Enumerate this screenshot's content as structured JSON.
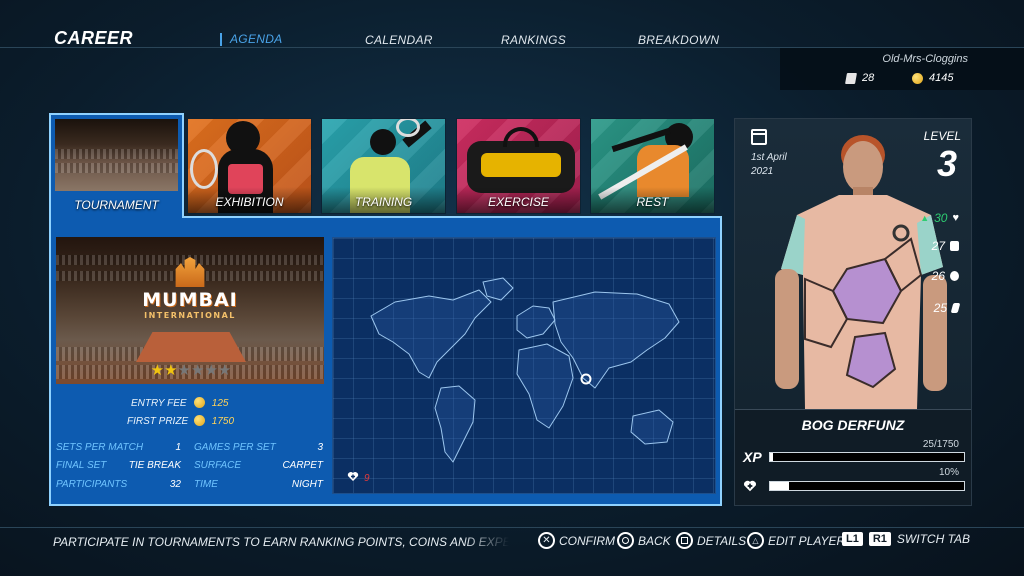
{
  "header": {
    "title": "CAREER",
    "tabs": [
      "AGENDA",
      "CALENDAR",
      "RANKINGS",
      "BREAKDOWN"
    ],
    "active_tab": "AGENDA"
  },
  "profile": {
    "username": "Old-Mrs-Cloggins",
    "cards": "28",
    "coins": "4145"
  },
  "activity_tabs": [
    "TOURNAMENT",
    "EXHIBITION",
    "TRAINING",
    "EXERCISE",
    "REST"
  ],
  "event": {
    "logo_name": "MUMBAI",
    "logo_sub": "INTERNATIONAL",
    "stars_filled": 2,
    "stars_total": 6,
    "entry_fee_label": "ENTRY FEE",
    "entry_fee": "125",
    "first_prize_label": "FIRST PRIZE",
    "first_prize": "1750",
    "sets_per_match_label": "SETS PER MATCH",
    "sets_per_match": "1",
    "games_per_set_label": "GAMES PER SET",
    "games_per_set": "3",
    "final_set_label": "FINAL SET",
    "final_set": "TIE BREAK",
    "surface_label": "SURFACE",
    "surface": "CARPET",
    "participants_label": "PARTICIPANTS",
    "participants": "32",
    "time_label": "TIME",
    "time": "NIGHT",
    "health_cost": "9"
  },
  "player": {
    "date_line1": "1st April",
    "date_line2": "2021",
    "level_label": "LEVEL",
    "level": "3",
    "health_change": "30",
    "stat2": "27",
    "stat3": "26",
    "stat4": "25",
    "name": "BOG DERFUNZ",
    "xp_label": "XP",
    "xp_text": "25/1750",
    "xp_fraction": 0.014,
    "health_pct_text": "10%",
    "health_fraction": 0.1
  },
  "footer": {
    "hint": "PARTICIPATE IN TOURNAMENTS TO EARN RANKING POINTS, COINS AND EXPERIEN",
    "confirm": "CONFIRM",
    "back": "BACK",
    "details": "DETAILS",
    "edit_player": "EDIT PLAYER",
    "l1": "L1",
    "r1": "R1",
    "switch_tab": "SWITCH TAB"
  }
}
